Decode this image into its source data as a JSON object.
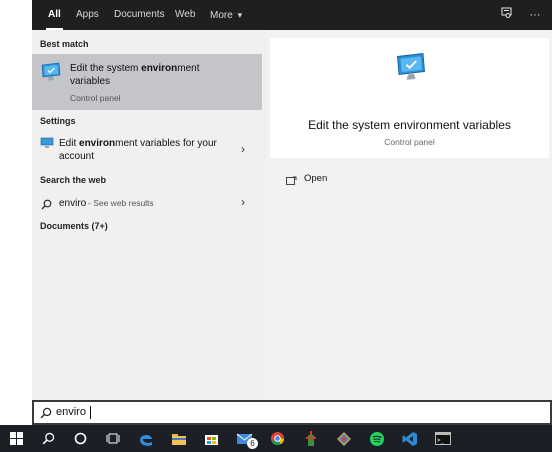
{
  "tabs": [
    {
      "label": "All",
      "active": true
    },
    {
      "label": "Apps"
    },
    {
      "label": "Documents"
    },
    {
      "label": "Web"
    },
    {
      "label": "More"
    }
  ],
  "more_arrow": "▾",
  "top_icons": {
    "feedback": "feedback-icon",
    "ellipsis": "···"
  },
  "left": {
    "best_match_heading": "Best match",
    "best_match": {
      "title_pre": "Edit the system ",
      "title_bold": "environ",
      "title_post": "ment",
      "title_line2": "variables",
      "subtitle": "Control panel"
    },
    "settings_heading": "Settings",
    "settings_item": {
      "pre": "Edit ",
      "bold": "environ",
      "post": "ment variables for your",
      "line2": "account"
    },
    "web_heading": "Search the web",
    "web_item": {
      "query": "enviro",
      "suffix": " - See web results"
    },
    "documents_heading": "Documents (7+)"
  },
  "right": {
    "title": "Edit the system environment variables",
    "subtitle": "Control panel",
    "action_open": "Open"
  },
  "search": {
    "value": "enviro"
  },
  "taskbar": {
    "items": [
      "windows-start",
      "search",
      "cortana",
      "task-view",
      "edge",
      "file-explorer",
      "store",
      "mail",
      "chrome",
      "app-green",
      "app-pinwheel",
      "spotify",
      "vscode",
      "terminal"
    ],
    "mail_badge": "6"
  },
  "colors": {
    "accent": "#0078d7",
    "topbar": "#1f1f1f",
    "selected": "#c3c5c8",
    "taskbar": "#1d1f26"
  }
}
